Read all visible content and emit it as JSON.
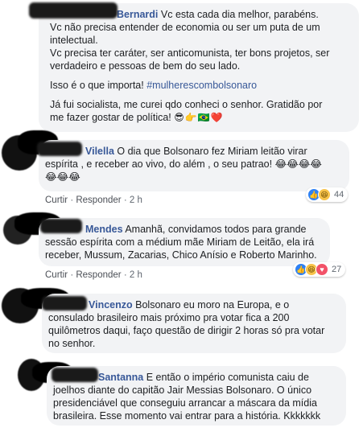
{
  "comments": [
    {
      "author": "Bernardi",
      "lines": [
        "Vc esta cada dia melhor, parabéns.",
        "Vc não precisa entender de economia ou ser um puta de um",
        "intelectual.",
        "Vc precisa ter caráter, ser anticomunista, ter bons projetos, ser",
        "verdadeiro e pessoas de bem do seu lado.",
        "",
        "Isso é o que importa!",
        "",
        "Já fui socialista, me curei qdo conheci o senhor. Gratidão por",
        "me fazer gostar de política!"
      ],
      "hashtag": "#mulherescombolsonaro",
      "emoji": "😎👉🇧🇷❤️"
    },
    {
      "author": "Vilella",
      "lines": [
        "O dia que Bolsonaro fez Miriam leitão virar",
        "espírita , e receber ao vivo, do além , o seu patrao! 😂😂😂😂",
        "😂😂😂"
      ],
      "actions": {
        "like": "Curtir",
        "reply": "Responder",
        "time": "2 h"
      },
      "reaction_count": "44"
    },
    {
      "author": "Mendes",
      "lines": [
        "Amanhã, convidamos todos para grande",
        "sessão espírita com a médium mãe Miriam de Leitão, ela irá",
        "receber, Mussum, Zacarias, Chico Anísio e Roberto Marinho."
      ],
      "actions": {
        "like": "Curtir",
        "reply": "Responder",
        "time": "2 h"
      },
      "reaction_count": "27"
    },
    {
      "author": "Vincenzo",
      "lines": [
        "Bolsonaro eu moro na Europa, e o",
        "consulado brasileiro mais próximo pra votar fica a 200",
        "quilômetros daqui, faço questão de dirigir 2 horas só pra votar",
        "no senhor."
      ]
    },
    {
      "author": "Santanna",
      "lines": [
        "E então o império comunista caiu de",
        "joelhos diante do capitão Jair Messias Bolsonaro. O único",
        "presidenciável que conseguiu arrancar a máscara da mídia",
        "brasileira. Esse momento vai entrar para a história. Kkkkkkk"
      ]
    }
  ]
}
